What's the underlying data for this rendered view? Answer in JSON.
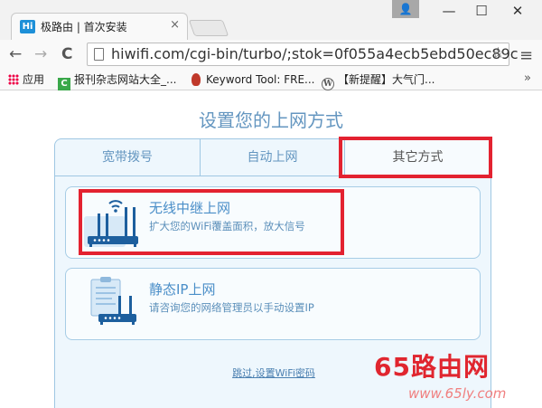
{
  "browser": {
    "tab_favicon": "Hi",
    "tab_title": "极路由 | 首次安装",
    "tab_close": "×",
    "url": "hiwifi.com/cgi-bin/turbo/;stok=0f055a4ecb5ebd50ec89c",
    "back": "←",
    "forward": "→",
    "reload": "C",
    "star": "☆",
    "menu": "≡",
    "minimize": "—",
    "maximize": "☐",
    "close": "✕",
    "profile": "👤"
  },
  "bookmarks": {
    "apps": "应用",
    "item1": "报刊杂志网站大全_...",
    "item1_icon": "C",
    "item2": "Keyword Tool: FRE...",
    "item3": "【新提醒】大气门...",
    "item3_icon": "W",
    "more": "»"
  },
  "page": {
    "title": "设置您的上网方式",
    "tabs": [
      {
        "label": "宽带拨号"
      },
      {
        "label": "自动上网"
      },
      {
        "label": "其它方式"
      }
    ],
    "options": [
      {
        "title": "无线中继上网",
        "subtitle": "扩大您的WiFi覆盖面积，放大信号"
      },
      {
        "title": "静态IP上网",
        "subtitle": "请咨询您的网络管理员以手动设置IP"
      }
    ],
    "skip_link": "跳过,设置WiFi密码"
  },
  "watermark": {
    "main": "65路由网",
    "url": "www.65ly.com"
  },
  "colors": {
    "accent": "#6496c0",
    "highlight": "#e32230",
    "panel_bg": "#eef7fd"
  }
}
